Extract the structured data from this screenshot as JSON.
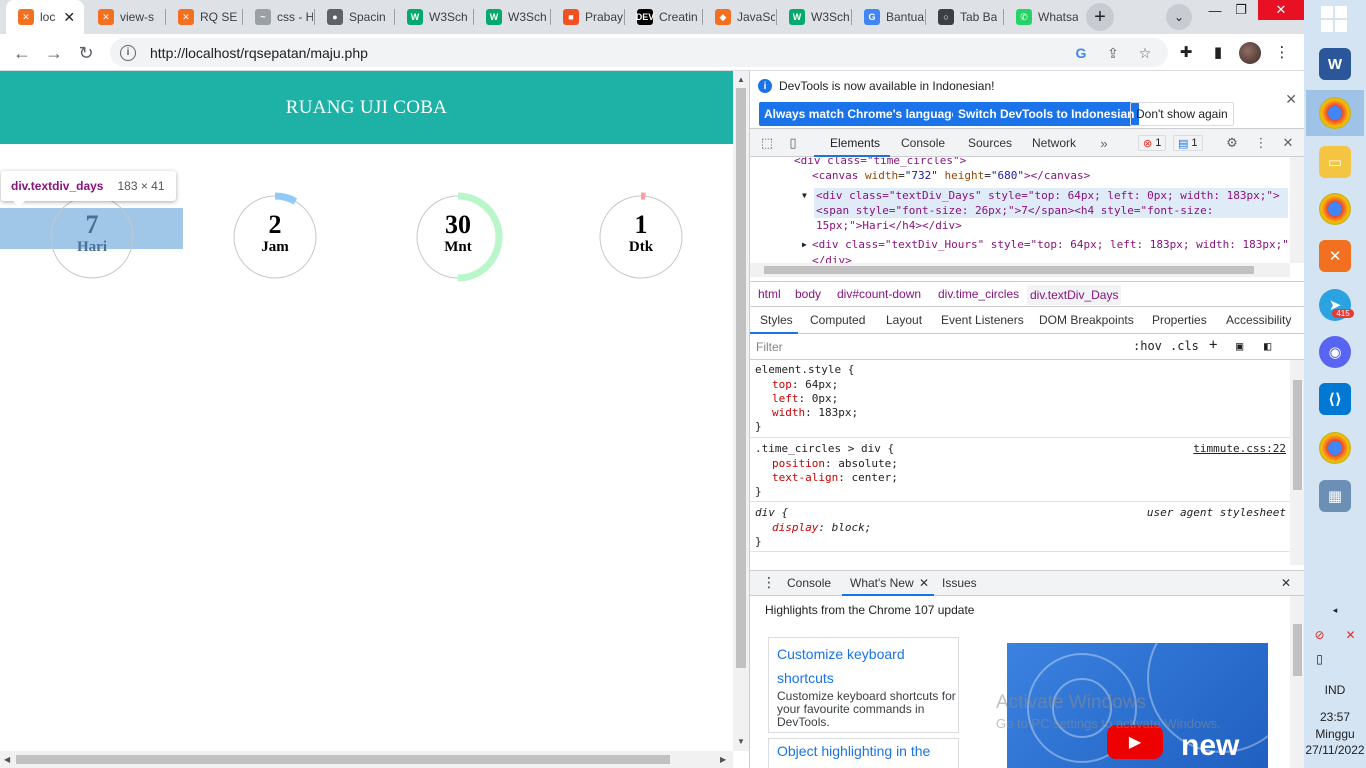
{
  "browser": {
    "tabs": [
      {
        "title": "loc",
        "fav_bg": "#f37021",
        "fav_glyph": "✕",
        "active": true
      },
      {
        "title": "view-s",
        "fav_bg": "#f37021",
        "fav_glyph": "✕"
      },
      {
        "title": "RQ SE",
        "fav_bg": "#f37021",
        "fav_glyph": "✕"
      },
      {
        "title": "css - H",
        "fav_bg": "#9aa0a6",
        "fav_glyph": "~"
      },
      {
        "title": "Spacin",
        "fav_bg": "#5f6368",
        "fav_glyph": "●"
      },
      {
        "title": "W3Sch",
        "fav_bg": "#04aa6d",
        "fav_glyph": "W"
      },
      {
        "title": "W3Sch",
        "fav_bg": "#04aa6d",
        "fav_glyph": "W"
      },
      {
        "title": "Prabay",
        "fav_bg": "#f25022",
        "fav_glyph": "■"
      },
      {
        "title": "Creatin",
        "fav_bg": "#000000",
        "fav_glyph": "DEV"
      },
      {
        "title": "JavaSc",
        "fav_bg": "#f37021",
        "fav_glyph": "◆"
      },
      {
        "title": "W3Sch",
        "fav_bg": "#04aa6d",
        "fav_glyph": "W"
      },
      {
        "title": "Bantua",
        "fav_bg": "#4285f4",
        "fav_glyph": "G"
      },
      {
        "title": "Tab Ba",
        "fav_bg": "#3c4043",
        "fav_glyph": "○"
      },
      {
        "title": "Whatsa",
        "fav_bg": "#25d366",
        "fav_glyph": "✆"
      }
    ],
    "url": "http://localhost/rqsepatan/maju.php",
    "icons": [
      "back-icon",
      "forward-icon",
      "reload-icon",
      "info-icon",
      "google-icon",
      "share-icon",
      "star-icon",
      "extensions-icon",
      "sidepanel-icon",
      "profile-avatar",
      "menu-icon"
    ]
  },
  "page": {
    "header": "RUANG UJI COBA",
    "header_color": "#1eb2a6",
    "countdown": [
      {
        "value": "7",
        "label": "Hari",
        "arc_fraction": 0.0,
        "arc_color": "#90c2f5"
      },
      {
        "value": "2",
        "label": "Jam",
        "arc_fraction": 0.083,
        "arc_color": "#90caf9"
      },
      {
        "value": "30",
        "label": "Mnt",
        "arc_fraction": 0.5,
        "arc_color": "#b9f6ca"
      },
      {
        "value": "1",
        "label": "Dtk",
        "arc_fraction": 0.017,
        "arc_color": "#ff9e9e"
      }
    ],
    "tooltip": {
      "name": "div.textdiv_days",
      "size": "183 × 41"
    }
  },
  "devtools": {
    "banner": {
      "text": "DevTools is now available in Indonesian!",
      "btn1": "Always match Chrome's language",
      "btn2": "Switch DevTools to Indonesian",
      "btn3": "Don't show again"
    },
    "tabs": [
      "Elements",
      "Console",
      "Sources",
      "Network"
    ],
    "errors": "1",
    "messages": "1",
    "dom": {
      "l1": "<div class=\"time_circles\">",
      "l2_tag": "<canvas",
      "l2_attr": " width",
      "l2_val": "\"732\"",
      "l2_attr2": " height",
      "l2_val2": "\"680\"",
      "l2_end": "></canvas>",
      "l3": "<div class=\"textDiv_Days\" style=\"top: 64px; left: 0px; width: 183px;\">",
      "l4": "<span style=\"font-size: 26px;\">7</span><h4 style=\"font-size:",
      "l5": "15px;\">Hari</h4></div>",
      "l6": "<div class=\"textDiv_Hours\" style=\"top: 64px; left: 183px; width: 183px;\"",
      "l7": "</div>"
    },
    "breadcrumbs": [
      "html",
      "body",
      "div#count-down",
      "div.time_circles",
      "div.textDiv_Days"
    ],
    "subtabs": [
      "Styles",
      "Computed",
      "Layout",
      "Event Listeners",
      "DOM Breakpoints",
      "Properties",
      "Accessibility"
    ],
    "filter_placeholder": "Filter",
    "hov": ":hov",
    "cls": ".cls",
    "styles": {
      "r1_sel": "element.style {",
      "r1_p1": "top",
      "r1_v1": "64px;",
      "r1_p2": "left",
      "r1_v2": "0px;",
      "r1_p3": "width",
      "r1_v3": "183px;",
      "r2_sel": ".time_circles > div {",
      "r2_src": "timmute.css:22",
      "r2_p1": "position",
      "r2_v1": "absolute;",
      "r2_p2": "text-align",
      "r2_v2": "center;",
      "r3_sel": "div {",
      "r3_src": "user agent stylesheet",
      "r3_p1": "display",
      "r3_v1": "block;",
      "close": "}"
    },
    "drawer": {
      "tabs": [
        "Console",
        "What's New",
        "Issues"
      ],
      "highlight": "Highlights from the Chrome 107 update",
      "card1_title": "Customize keyboard shortcuts",
      "card1_desc": "Customize keyboard shortcuts for your favourite commands in DevTools.",
      "card2_title": "Object highlighting in the",
      "video_text": "new"
    },
    "watermark1": "Activate Windows",
    "watermark2": "Go to PC settings to activate Windows."
  },
  "taskbar": {
    "lang": "IND",
    "time": "23:57",
    "day": "Minggu",
    "date": "27/11/2022",
    "telegram_badge": "415"
  }
}
